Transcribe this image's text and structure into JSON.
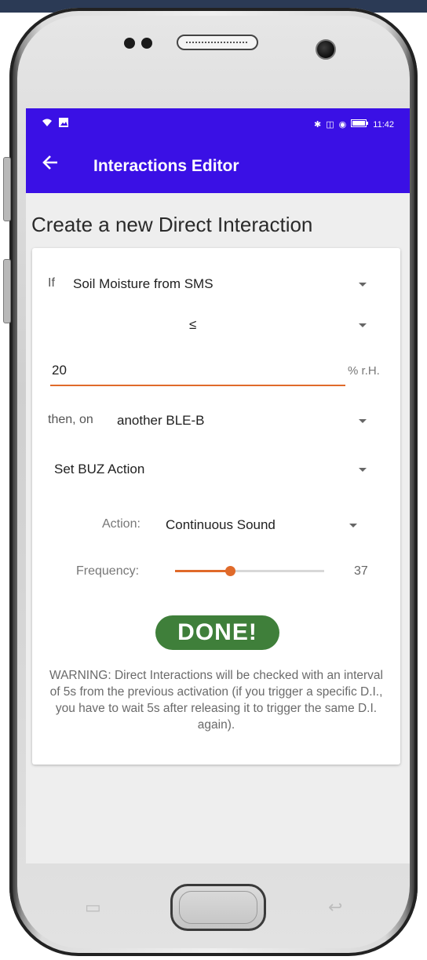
{
  "status_bar": {
    "left_icons": [
      "wifi-icon",
      "image-icon"
    ],
    "right_icons": [
      "bluetooth-icon",
      "vibrate-icon",
      "location-icon",
      "battery-icon"
    ],
    "time": "11:42"
  },
  "app_bar": {
    "back_icon": "arrow-left-icon",
    "title": "Interactions Editor"
  },
  "page": {
    "heading": "Create a new Direct Interaction"
  },
  "form": {
    "if_label": "If",
    "sensor_value": "Soil Moisture from SMS",
    "operator_value": "≤",
    "threshold_value": "20",
    "threshold_unit": "% r.H.",
    "then_label": "then, on",
    "target_value": "another BLE-B",
    "action_type_value": "Set BUZ Action",
    "action_label": "Action:",
    "action_value": "Continuous Sound",
    "frequency_label": "Frequency:",
    "frequency_value": "37",
    "frequency_fraction": 0.37
  },
  "done_button": "DONE!",
  "warning_text": "WARNING: Direct Interactions will be checked with an interval of 5s from the previous activation (if you trigger a specific D.I., you have to wait 5s after releasing it to trigger the same D.I. again).",
  "colors": {
    "app_bar": "#3a10e5",
    "accent": "#e06a2a",
    "done_button": "#3f7f3a"
  }
}
